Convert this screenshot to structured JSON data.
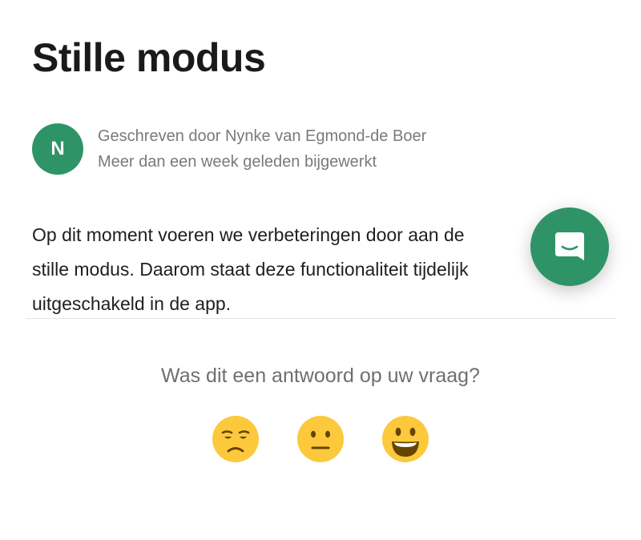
{
  "article": {
    "title": "Stille modus",
    "author_initial": "N",
    "author_line": "Geschreven door Nynke van Egmond-de Boer",
    "updated_line": "Meer dan een week geleden bijgewerkt",
    "body_lines": [
      "Op dit moment voeren we verbeteringen door aan de",
      "stille modus. Daarom staat deze functionaliteit tijdelijk",
      "uitgeschakeld in de app."
    ]
  },
  "feedback": {
    "question": "Was dit een antwoord op uw vraag?",
    "reactions": [
      "disappointed-face-icon",
      "neutral-face-icon",
      "smiley-face-icon"
    ]
  },
  "chat_button": {
    "icon": "chat-bubble-icon"
  },
  "colors": {
    "accent": "#2e9467",
    "emoji_yellow": "#fcc93d",
    "emoji_dark": "#664500",
    "text_primary": "#1a1a1a",
    "text_muted": "#7a7a7a"
  }
}
